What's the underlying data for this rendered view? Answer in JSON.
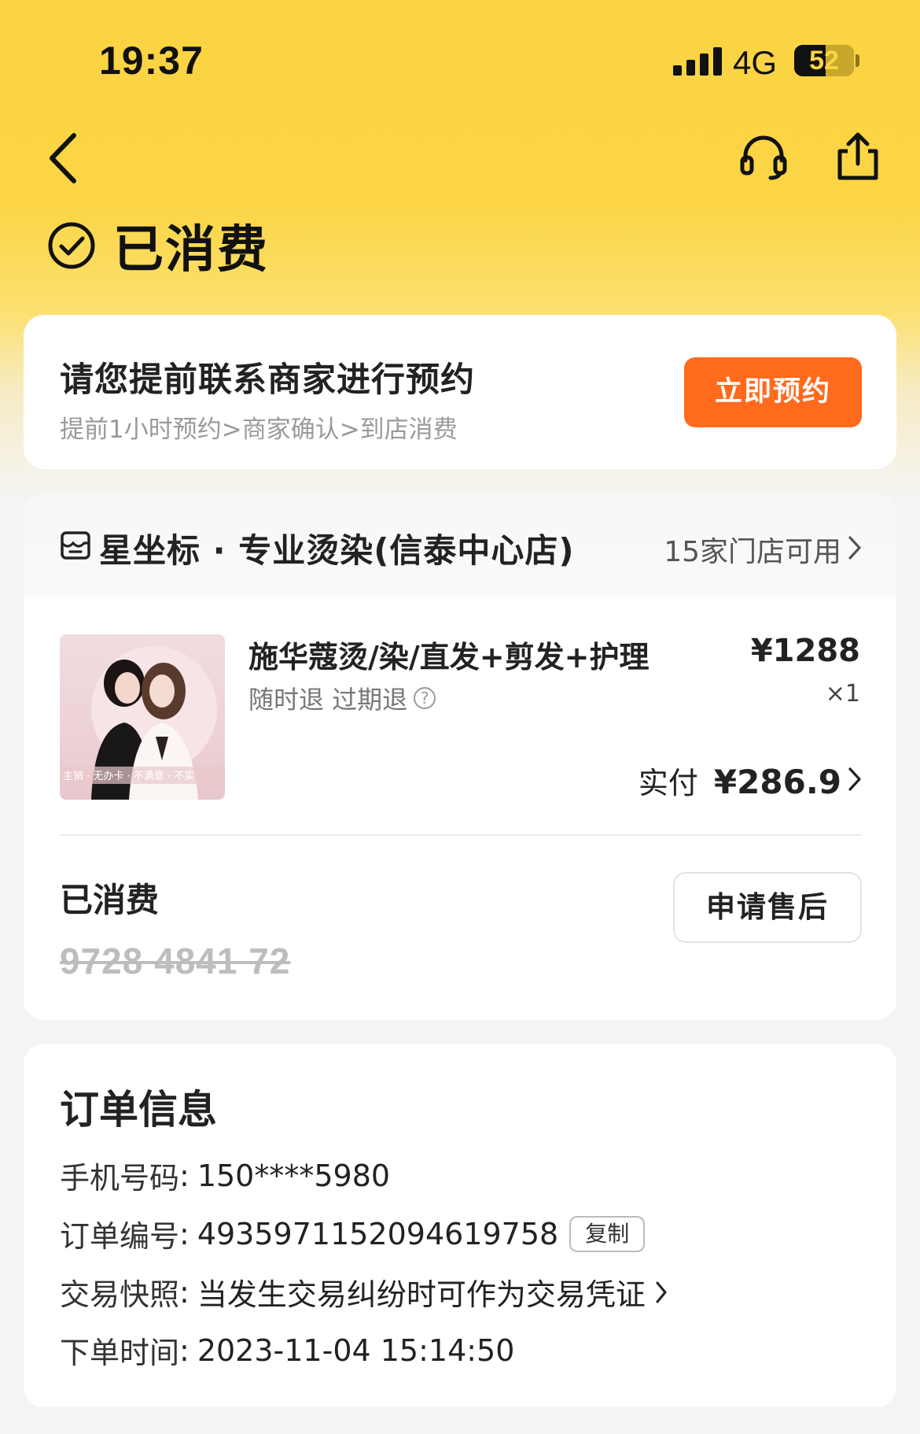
{
  "status_bar": {
    "time": "19:37",
    "network": "4G",
    "battery": "52"
  },
  "nav": {
    "back_icon": "chevron-left-icon",
    "service_icon": "headset-icon",
    "share_icon": "share-icon"
  },
  "order_status": {
    "title": "已消费",
    "icon": "check-circle-icon"
  },
  "reserve_card": {
    "title": "请您提前联系商家进行预约",
    "subtitle": "提前1小时预约>商家确认>到店消费",
    "button_label": "立即预约",
    "button_color": "#ff6a1c"
  },
  "store": {
    "icon": "store-icon",
    "name": "星坐标 · 专业烫染(信泰中心店)",
    "available": "15家门店可用"
  },
  "product": {
    "image_alt": "hair-salon-product-image",
    "name": "施华蔻烫/染/直发+剪发+护理",
    "tags": "随时退  过期退",
    "price": "¥1288",
    "qty": "×1",
    "paid_label": "实付",
    "paid_value": "¥286.9"
  },
  "voucher": {
    "status": "已消费",
    "code": "9728 4841 72",
    "after_sale_label": "申请售后"
  },
  "order_info": {
    "title": "订单信息",
    "rows": [
      {
        "key": "手机号码",
        "value": "150****5980"
      },
      {
        "key": "订单编号",
        "value": "4935971152094619758",
        "copy_label": "复制"
      },
      {
        "key": "交易快照",
        "value": "当发生交易纠纷时可作为交易凭证"
      },
      {
        "key": "下单时间",
        "value": "2023-11-04 15:14:50"
      }
    ]
  },
  "colors": {
    "header_yellow": "#fbd443",
    "accent_orange": "#ff6a1c"
  }
}
